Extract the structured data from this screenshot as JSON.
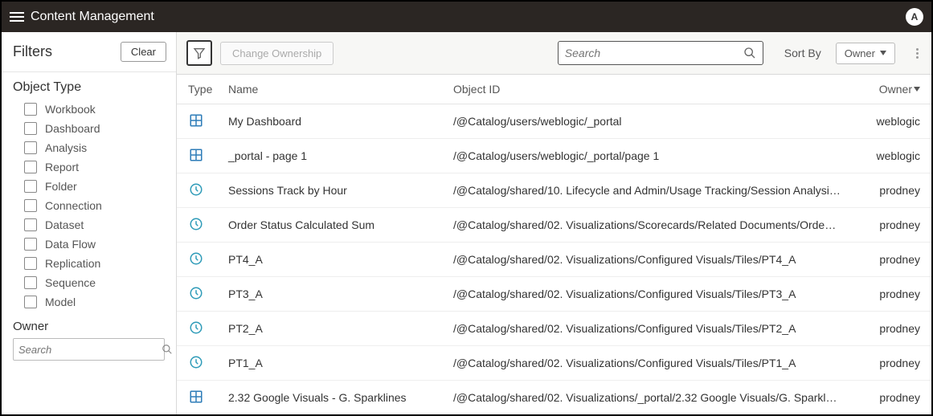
{
  "header": {
    "title": "Content Management",
    "avatar_initial": "A"
  },
  "sidebar": {
    "filters_title": "Filters",
    "clear_label": "Clear",
    "object_type_title": "Object Type",
    "types": [
      {
        "label": "Workbook"
      },
      {
        "label": "Dashboard"
      },
      {
        "label": "Analysis"
      },
      {
        "label": "Report"
      },
      {
        "label": "Folder"
      },
      {
        "label": "Connection"
      },
      {
        "label": "Dataset"
      },
      {
        "label": "Data Flow"
      },
      {
        "label": "Replication"
      },
      {
        "label": "Sequence"
      },
      {
        "label": "Model"
      }
    ],
    "owner_title": "Owner",
    "owner_search_placeholder": "Search"
  },
  "toolbar": {
    "change_ownership_label": "Change Ownership",
    "search_placeholder": "Search",
    "sort_by_label": "Sort By",
    "sort_value": "Owner"
  },
  "table": {
    "headers": {
      "type": "Type",
      "name": "Name",
      "object_id": "Object ID",
      "owner": "Owner"
    },
    "rows": [
      {
        "icon": "dashboard",
        "name": "My Dashboard",
        "object_id": "/@Catalog/users/weblogic/_portal",
        "owner": "weblogic"
      },
      {
        "icon": "dashboard",
        "name": "_portal - page 1",
        "object_id": "/@Catalog/users/weblogic/_portal/page 1",
        "owner": "weblogic"
      },
      {
        "icon": "analysis",
        "name": "Sessions Track by Hour",
        "object_id": "/@Catalog/shared/10. Lifecycle and Admin/Usage Tracking/Session Analysi…",
        "owner": "prodney"
      },
      {
        "icon": "analysis",
        "name": "Order Status Calculated Sum",
        "object_id": "/@Catalog/shared/02. Visualizations/Scorecards/Related Documents/Orde…",
        "owner": "prodney"
      },
      {
        "icon": "analysis",
        "name": "PT4_A",
        "object_id": "/@Catalog/shared/02. Visualizations/Configured Visuals/Tiles/PT4_A",
        "owner": "prodney"
      },
      {
        "icon": "analysis",
        "name": "PT3_A",
        "object_id": "/@Catalog/shared/02. Visualizations/Configured Visuals/Tiles/PT3_A",
        "owner": "prodney"
      },
      {
        "icon": "analysis",
        "name": "PT2_A",
        "object_id": "/@Catalog/shared/02. Visualizations/Configured Visuals/Tiles/PT2_A",
        "owner": "prodney"
      },
      {
        "icon": "analysis",
        "name": "PT1_A",
        "object_id": "/@Catalog/shared/02. Visualizations/Configured Visuals/Tiles/PT1_A",
        "owner": "prodney"
      },
      {
        "icon": "dashboard",
        "name": "2.32 Google Visuals - G. Sparklines",
        "object_id": "/@Catalog/shared/02. Visualizations/_portal/2.32 Google Visuals/G. Sparkl…",
        "owner": "prodney"
      }
    ]
  }
}
